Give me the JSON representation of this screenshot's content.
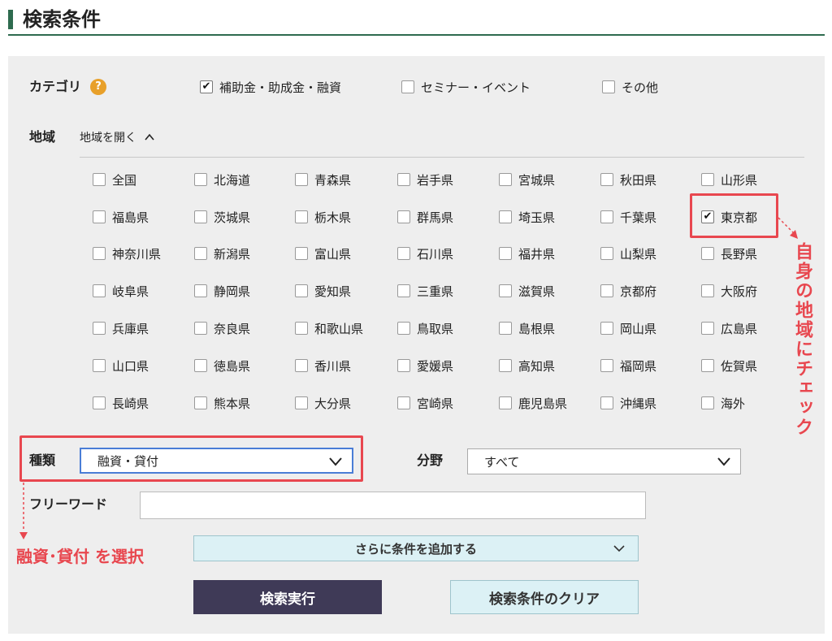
{
  "header": {
    "title": "検索条件"
  },
  "category": {
    "label": "カテゴリ",
    "help_glyph": "?",
    "options": [
      {
        "label": "補助金・助成金・融資",
        "checked": true
      },
      {
        "label": "セミナー・イベント",
        "checked": false
      },
      {
        "label": "その他",
        "checked": false
      }
    ]
  },
  "region": {
    "label": "地域",
    "toggle_label": "地域を開く",
    "prefectures": [
      {
        "label": "全国",
        "checked": false
      },
      {
        "label": "北海道",
        "checked": false
      },
      {
        "label": "青森県",
        "checked": false
      },
      {
        "label": "岩手県",
        "checked": false
      },
      {
        "label": "宮城県",
        "checked": false
      },
      {
        "label": "秋田県",
        "checked": false
      },
      {
        "label": "山形県",
        "checked": false
      },
      {
        "label": "福島県",
        "checked": false
      },
      {
        "label": "茨城県",
        "checked": false
      },
      {
        "label": "栃木県",
        "checked": false
      },
      {
        "label": "群馬県",
        "checked": false
      },
      {
        "label": "埼玉県",
        "checked": false
      },
      {
        "label": "千葉県",
        "checked": false
      },
      {
        "label": "東京都",
        "checked": true
      },
      {
        "label": "神奈川県",
        "checked": false
      },
      {
        "label": "新潟県",
        "checked": false
      },
      {
        "label": "富山県",
        "checked": false
      },
      {
        "label": "石川県",
        "checked": false
      },
      {
        "label": "福井県",
        "checked": false
      },
      {
        "label": "山梨県",
        "checked": false
      },
      {
        "label": "長野県",
        "checked": false
      },
      {
        "label": "岐阜県",
        "checked": false
      },
      {
        "label": "静岡県",
        "checked": false
      },
      {
        "label": "愛知県",
        "checked": false
      },
      {
        "label": "三重県",
        "checked": false
      },
      {
        "label": "滋賀県",
        "checked": false
      },
      {
        "label": "京都府",
        "checked": false
      },
      {
        "label": "大阪府",
        "checked": false
      },
      {
        "label": "兵庫県",
        "checked": false
      },
      {
        "label": "奈良県",
        "checked": false
      },
      {
        "label": "和歌山県",
        "checked": false
      },
      {
        "label": "鳥取県",
        "checked": false
      },
      {
        "label": "島根県",
        "checked": false
      },
      {
        "label": "岡山県",
        "checked": false
      },
      {
        "label": "広島県",
        "checked": false
      },
      {
        "label": "山口県",
        "checked": false
      },
      {
        "label": "徳島県",
        "checked": false
      },
      {
        "label": "香川県",
        "checked": false
      },
      {
        "label": "愛媛県",
        "checked": false
      },
      {
        "label": "高知県",
        "checked": false
      },
      {
        "label": "福岡県",
        "checked": false
      },
      {
        "label": "佐賀県",
        "checked": false
      },
      {
        "label": "長崎県",
        "checked": false
      },
      {
        "label": "熊本県",
        "checked": false
      },
      {
        "label": "大分県",
        "checked": false
      },
      {
        "label": "宮崎県",
        "checked": false
      },
      {
        "label": "鹿児島県",
        "checked": false
      },
      {
        "label": "沖縄県",
        "checked": false
      },
      {
        "label": "海外",
        "checked": false
      }
    ]
  },
  "type": {
    "label": "種類",
    "selected": "融資・貸付"
  },
  "field": {
    "label": "分野",
    "selected": "すべて"
  },
  "freeword": {
    "label": "フリーワード",
    "value": ""
  },
  "add_conditions": {
    "label": "さらに条件を追加する"
  },
  "buttons": {
    "search": "検索実行",
    "clear": "検索条件のクリア"
  },
  "annotations": {
    "region_note": "自身の地域にチェック",
    "type_note": "融資･貸付 を選択"
  },
  "colors": {
    "accent_green": "#2e6b4f",
    "annotation_red": "#e8474f",
    "search_button": "#3f3a57",
    "light_button": "#dcf1f5",
    "help_icon": "#e8a02a"
  }
}
